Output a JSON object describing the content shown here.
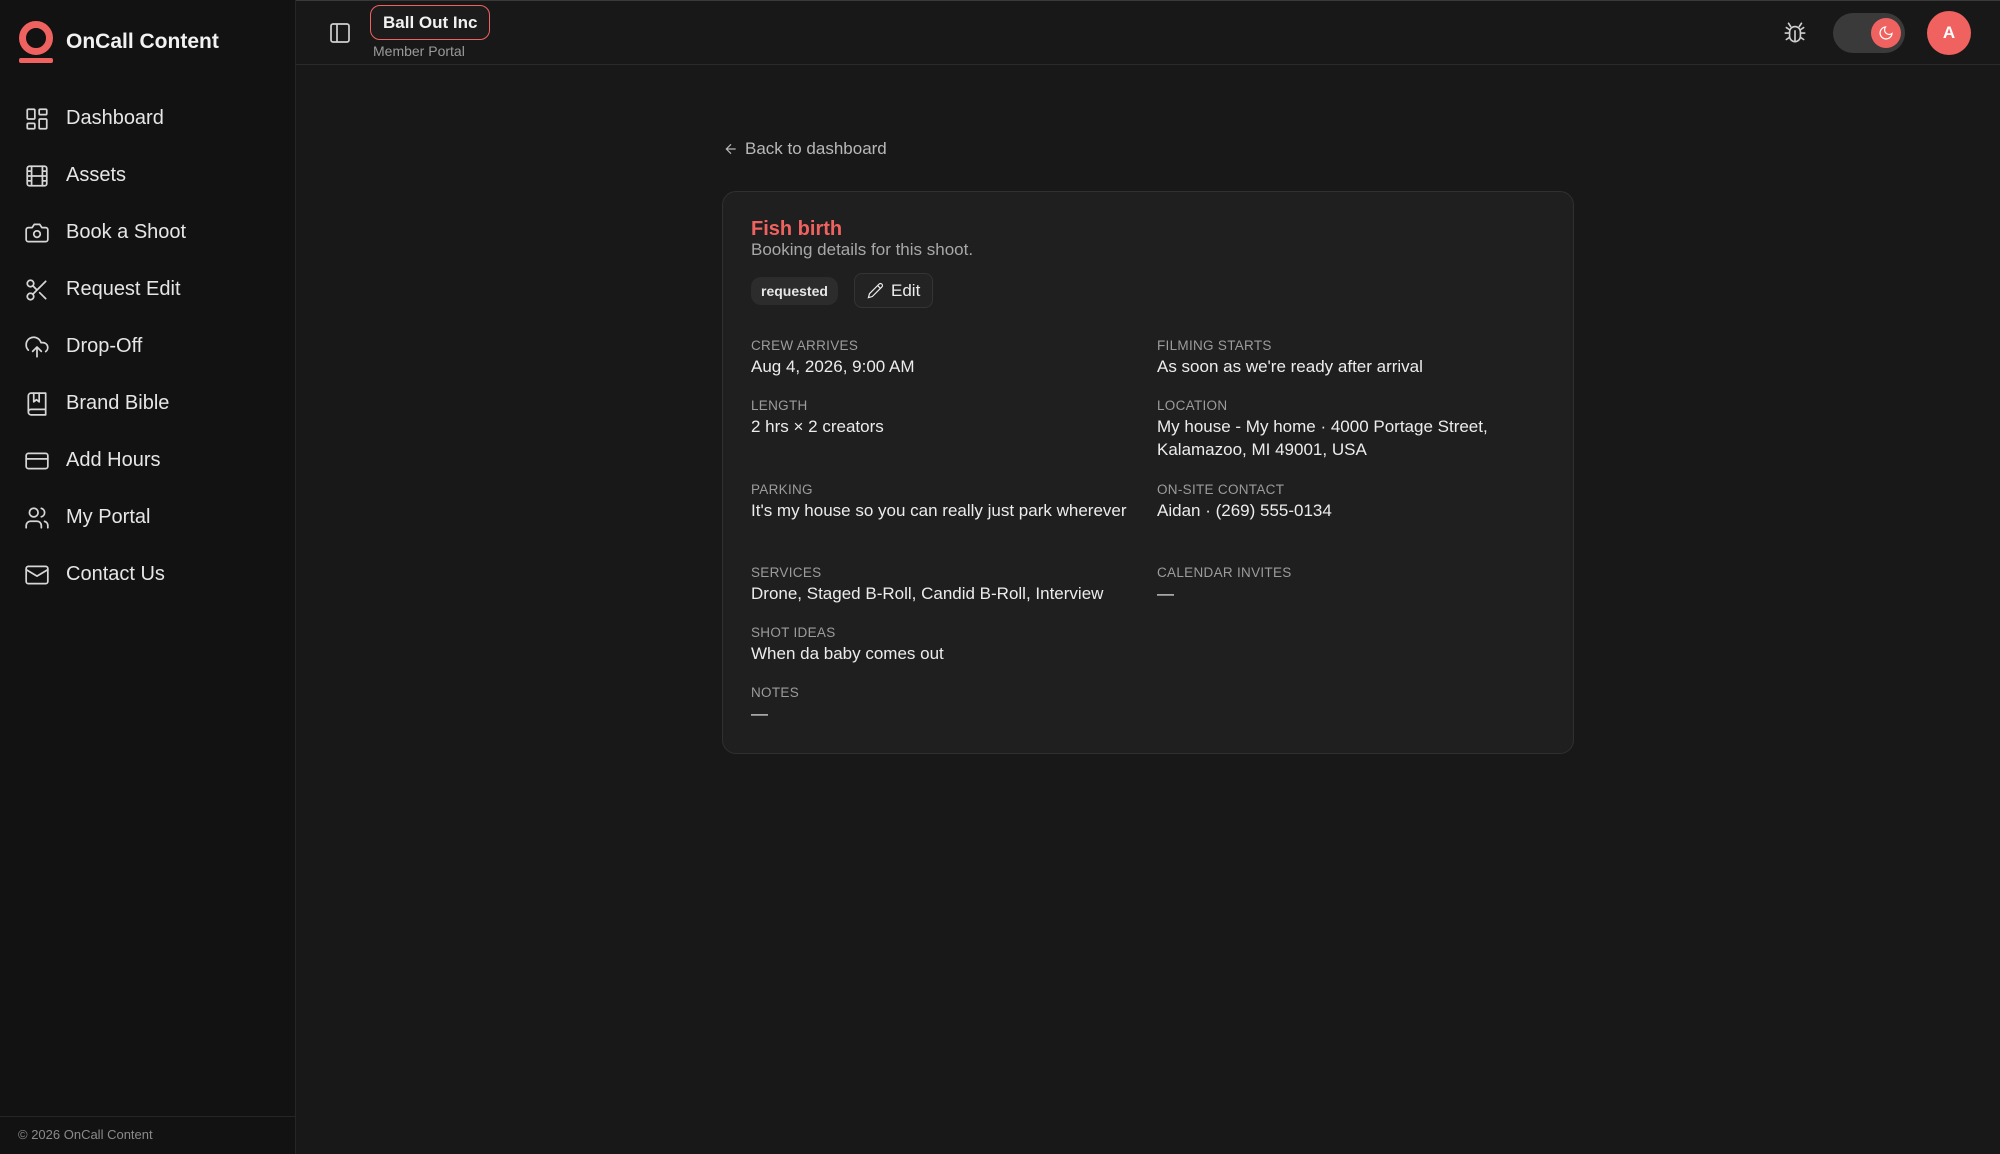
{
  "brand": {
    "name": "OnCall Content",
    "accent": "#f0625f"
  },
  "sidebar": {
    "items": [
      {
        "label": "Dashboard",
        "icon": "dashboard-icon"
      },
      {
        "label": "Assets",
        "icon": "film-icon"
      },
      {
        "label": "Book a Shoot",
        "icon": "camera-icon"
      },
      {
        "label": "Request Edit",
        "icon": "scissors-icon"
      },
      {
        "label": "Drop-Off",
        "icon": "cloud-upload-icon"
      },
      {
        "label": "Brand Bible",
        "icon": "book-icon"
      },
      {
        "label": "Add Hours",
        "icon": "credit-card-icon"
      },
      {
        "label": "My Portal",
        "icon": "users-icon"
      },
      {
        "label": "Contact Us",
        "icon": "mail-icon"
      }
    ],
    "footer": "© 2026 OnCall Content"
  },
  "header": {
    "org_name": "Ball Out Inc",
    "org_sub": "Member Portal",
    "avatar_initial": "A"
  },
  "main": {
    "back_label": "Back to dashboard",
    "card": {
      "title": "Fish birth",
      "subtitle": "Booking details for this shoot.",
      "status": "requested",
      "edit_label": "Edit",
      "fields": {
        "crew_arrives": {
          "label": "CREW ARRIVES",
          "value": "Aug 4, 2026, 9:00 AM"
        },
        "filming_starts": {
          "label": "FILMING STARTS",
          "value": "As soon as we're ready after arrival"
        },
        "length": {
          "label": "LENGTH",
          "value": "2 hrs × 2 creators"
        },
        "location": {
          "label": "LOCATION",
          "value": "My house - My home · 4000 Portage Street, Kalamazoo, MI 49001, USA"
        },
        "parking": {
          "label": "PARKING",
          "value": "It's my house so you can really just park wherever"
        },
        "onsite_contact": {
          "label": "ON-SITE CONTACT",
          "value": "Aidan · (269) 555-0134"
        },
        "services": {
          "label": "SERVICES",
          "value": "Drone, Staged B-Roll, Candid B-Roll, Interview"
        },
        "calendar_invites": {
          "label": "CALENDAR INVITES",
          "value": "—"
        },
        "shot_ideas": {
          "label": "SHOT IDEAS",
          "value": "When da baby comes out"
        },
        "notes": {
          "label": "NOTES",
          "value": "—"
        }
      }
    }
  }
}
